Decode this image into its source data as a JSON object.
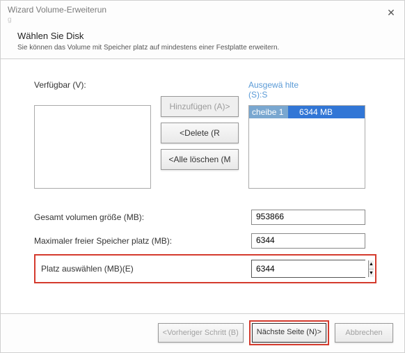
{
  "title": {
    "main": "Wizard Volume-Erweiterun",
    "sub": "g"
  },
  "header": {
    "heading": "Wählen Sie Disk",
    "desc": "Sie können das Volume mit Speicher platz auf mindestens einer Festplatte erweitern."
  },
  "labels": {
    "available": "Verfügbar (V):",
    "selected": "Ausgewä hlte (S):S",
    "total": "Gesamt volumen größe (MB):",
    "maxfree": "Maximaler freier Speicher platz (MB):",
    "choose": "Platz auswählen (MB)(E)"
  },
  "buttons": {
    "add": "Hinzufügen (A)>",
    "delete": "<Delete (R",
    "deleteAll": "<Alle löschen (M",
    "prev": "<Vorheriger Schritt (B)",
    "next": "Nächste Seite (N)>",
    "cancel": "Abbrechen"
  },
  "selectedList": [
    {
      "disk": "cheibe 1",
      "size": "6344 MB"
    }
  ],
  "values": {
    "total": "953866",
    "maxfree": "6344",
    "choose": "6344"
  }
}
